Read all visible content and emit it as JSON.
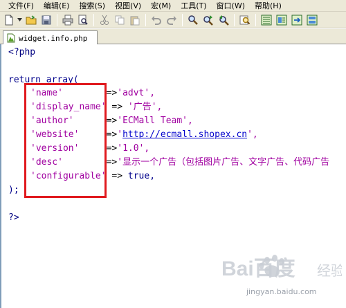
{
  "menubar": {
    "items": [
      {
        "label": "文件(F)"
      },
      {
        "label": "编辑(E)"
      },
      {
        "label": "搜索(S)"
      },
      {
        "label": "视图(V)"
      },
      {
        "label": "宏(M)"
      },
      {
        "label": "工具(T)"
      },
      {
        "label": "窗口(W)"
      },
      {
        "label": "帮助(H)"
      }
    ]
  },
  "toolbar": {
    "icons": [
      "new-file-icon",
      "open-folder-icon",
      "save-icon",
      "print-icon",
      "print-preview-icon",
      "cut-icon",
      "copy-icon",
      "paste-icon",
      "undo-icon",
      "redo-icon",
      "find-icon",
      "find-next-icon",
      "find-prev-icon",
      "find-in-files-icon",
      "view-mode-icon-1",
      "view-mode-icon-2",
      "view-mode-icon-3",
      "view-mode-icon-4"
    ]
  },
  "tab": {
    "filename": "widget.info.php"
  },
  "code": {
    "line1": "<?php",
    "return_kw": "return",
    "array_kw": "array(",
    "entries": [
      {
        "key": "'name'",
        "sep": "        =>",
        "value": "'advt',"
      },
      {
        "key": "'display_name'",
        "sep": " => ",
        "value": "'广告',"
      },
      {
        "key": "'author'",
        "sep": "      =>",
        "value": "'ECMall Team',"
      },
      {
        "key": "'website'",
        "sep": "     =>",
        "value_prefix": "'",
        "url": "http://ecmall.shopex.cn",
        "value_suffix": "',"
      },
      {
        "key": "'version'",
        "sep": "     =>",
        "value": "'1.0',"
      },
      {
        "key": "'desc'",
        "sep": "        =>",
        "value": "'显示一个广告（包括图片广告、文字广告、代码广告"
      },
      {
        "key": "'configurable'",
        "sep": " => ",
        "value": "true,"
      }
    ],
    "close": ");",
    "end_tag": "?>"
  },
  "watermark": {
    "logo_text": "Bai百度",
    "sub_text": "经验",
    "url": "jingyan.baidu.com"
  },
  "colors": {
    "highlight_border": "#e0191e",
    "string": "#a000a0",
    "keyword": "#00008b"
  }
}
